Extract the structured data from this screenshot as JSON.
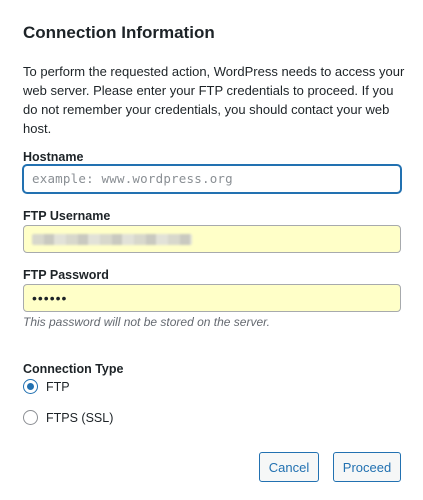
{
  "dialog": {
    "title": "Connection Information",
    "intro": "To perform the requested action, WordPress needs to access your web server. Please enter your FTP credentials to proceed. If you do not remember your credentials, you should contact your web host."
  },
  "hostname": {
    "label": "Hostname",
    "placeholder": "example: www.wordpress.org",
    "value": ""
  },
  "username": {
    "label": "FTP Username",
    "value": ""
  },
  "password": {
    "label": "FTP Password",
    "value": "••••••",
    "note": "This password will not be stored on the server."
  },
  "connection_type": {
    "label": "Connection Type",
    "options": [
      {
        "label": "FTP",
        "selected": true
      },
      {
        "label": "FTPS (SSL)",
        "selected": false
      }
    ]
  },
  "buttons": {
    "cancel": "Cancel",
    "proceed": "Proceed"
  },
  "colors": {
    "accent": "#2271b1",
    "autofill": "#ffffc8"
  }
}
